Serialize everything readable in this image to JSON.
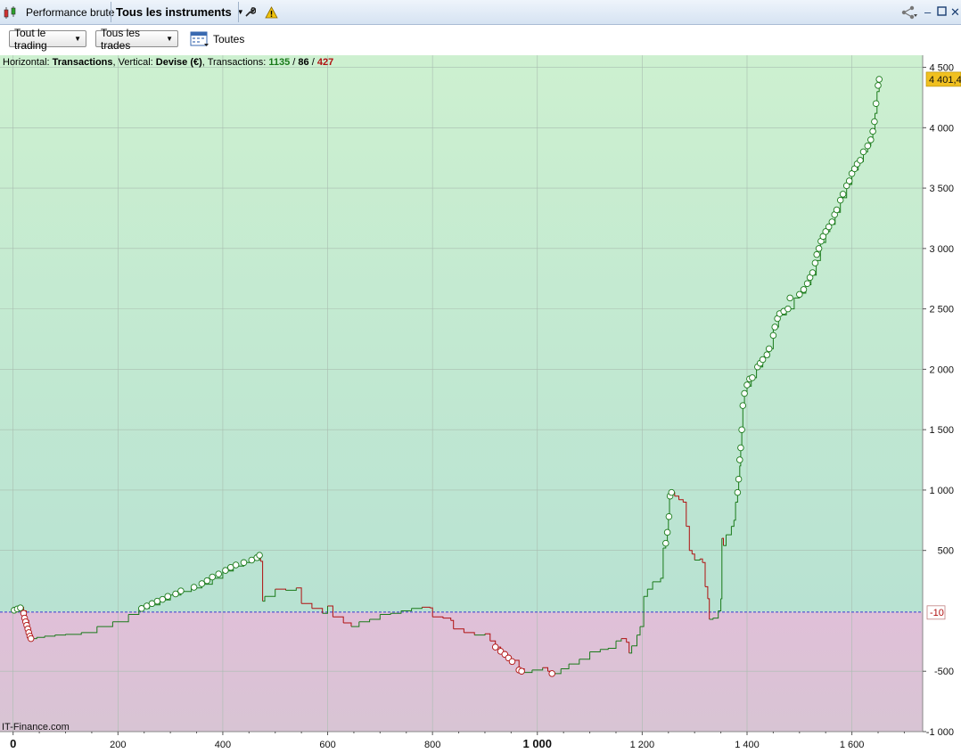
{
  "titlebar": {
    "tab_performance": "Performance brute",
    "tab_instruments": "Tous les instruments"
  },
  "toolbar": {
    "trading_filter": "Tout le trading",
    "trades_filter": "Tous les trades",
    "period_label": "Toutes"
  },
  "info": {
    "horizontal_prefix": "Horizontal: ",
    "horizontal_value": "Transactions",
    "vertical_prefix": ", Vertical: ",
    "vertical_value": "Devise (€)",
    "transactions_prefix": ", Transactions: ",
    "count_total": "1135",
    "sep1": " / ",
    "count_neutral": "86",
    "sep2": " / ",
    "count_losing": "427"
  },
  "watermark": "IT-Finance.com",
  "colors": {
    "profit_line": "#1a7a1a",
    "loss_line": "#b01010",
    "profit_zone": "#c8ecd0",
    "loss_zone": "#dcc2d4",
    "baseline": "#3a3ad0",
    "last_value_badge": "#f0c020"
  },
  "chart_data": {
    "type": "line",
    "xlabel": "Transactions",
    "ylabel": "Devise (€)",
    "xlim": [
      -25,
      1735
    ],
    "ylim": [
      -1000,
      4600
    ],
    "baseline_value": -10,
    "baseline_label": "-10",
    "last_value": 4401.4,
    "last_value_label": "4 401,4",
    "x_ticks": [
      {
        "v": 0,
        "label": "0",
        "bold": true
      },
      {
        "v": 200,
        "label": "200"
      },
      {
        "v": 400,
        "label": "400"
      },
      {
        "v": 600,
        "label": "600"
      },
      {
        "v": 800,
        "label": "800"
      },
      {
        "v": 1000,
        "label": "1 000",
        "bold": true
      },
      {
        "v": 1200,
        "label": "1 200"
      },
      {
        "v": 1400,
        "label": "1 400"
      },
      {
        "v": 1600,
        "label": "1 600"
      }
    ],
    "y_ticks": [
      {
        "v": 4500,
        "label": "4 500"
      },
      {
        "v": 4000,
        "label": "4 000"
      },
      {
        "v": 3500,
        "label": "3 500"
      },
      {
        "v": 3000,
        "label": "3 000"
      },
      {
        "v": 2500,
        "label": "2 500"
      },
      {
        "v": 2000,
        "label": "2 000"
      },
      {
        "v": 1500,
        "label": "1 500"
      },
      {
        "v": 1000,
        "label": "1 000"
      },
      {
        "v": 500,
        "label": "500"
      },
      {
        "v": -500,
        "label": "-500"
      },
      {
        "v": -1000,
        "label": "-1 000"
      }
    ],
    "series": [
      {
        "points": [
          [
            0,
            0
          ],
          [
            10,
            20
          ],
          [
            15,
            30
          ],
          [
            20,
            0
          ],
          [
            25,
            -80
          ],
          [
            30,
            -150
          ],
          [
            33,
            -200
          ],
          [
            36,
            -230
          ],
          [
            45,
            -220
          ],
          [
            60,
            -210
          ],
          [
            80,
            -200
          ],
          [
            100,
            -195
          ],
          [
            130,
            -180
          ],
          [
            160,
            -130
          ],
          [
            190,
            -90
          ],
          [
            220,
            -30
          ],
          [
            240,
            20
          ],
          [
            260,
            50
          ],
          [
            280,
            90
          ],
          [
            300,
            130
          ],
          [
            320,
            160
          ],
          [
            340,
            190
          ],
          [
            360,
            220
          ],
          [
            380,
            270
          ],
          [
            400,
            330
          ],
          [
            420,
            370
          ],
          [
            440,
            400
          ],
          [
            455,
            420
          ],
          [
            470,
            460
          ],
          [
            472,
            410
          ],
          [
            476,
            80
          ],
          [
            480,
            120
          ],
          [
            500,
            180
          ],
          [
            520,
            170
          ],
          [
            540,
            190
          ],
          [
            550,
            60
          ],
          [
            570,
            20
          ],
          [
            590,
            -20
          ],
          [
            600,
            40
          ],
          [
            610,
            -50
          ],
          [
            630,
            -100
          ],
          [
            645,
            -130
          ],
          [
            660,
            -90
          ],
          [
            680,
            -70
          ],
          [
            700,
            -30
          ],
          [
            720,
            -20
          ],
          [
            740,
            0
          ],
          [
            760,
            20
          ],
          [
            780,
            30
          ],
          [
            795,
            25
          ],
          [
            800,
            -50
          ],
          [
            820,
            -60
          ],
          [
            835,
            -80
          ],
          [
            840,
            -150
          ],
          [
            860,
            -180
          ],
          [
            880,
            -200
          ],
          [
            900,
            -190
          ],
          [
            910,
            -250
          ],
          [
            920,
            -300
          ],
          [
            930,
            -340
          ],
          [
            940,
            -380
          ],
          [
            950,
            -410
          ],
          [
            965,
            -480
          ],
          [
            975,
            -510
          ],
          [
            990,
            -490
          ],
          [
            1010,
            -470
          ],
          [
            1020,
            -500
          ],
          [
            1030,
            -520
          ],
          [
            1045,
            -480
          ],
          [
            1060,
            -440
          ],
          [
            1080,
            -400
          ],
          [
            1100,
            -340
          ],
          [
            1120,
            -320
          ],
          [
            1135,
            -310
          ],
          [
            1150,
            -250
          ],
          [
            1160,
            -230
          ],
          [
            1170,
            -260
          ],
          [
            1175,
            -350
          ],
          [
            1180,
            -290
          ],
          [
            1190,
            -200
          ],
          [
            1196,
            -130
          ],
          [
            1203,
            120
          ],
          [
            1210,
            180
          ],
          [
            1220,
            240
          ],
          [
            1235,
            270
          ],
          [
            1240,
            520
          ],
          [
            1245,
            560
          ],
          [
            1248,
            650
          ],
          [
            1250,
            780
          ],
          [
            1252,
            950
          ],
          [
            1256,
            980
          ],
          [
            1262,
            950
          ],
          [
            1270,
            920
          ],
          [
            1278,
            900
          ],
          [
            1284,
            700
          ],
          [
            1290,
            500
          ],
          [
            1295,
            470
          ],
          [
            1300,
            420
          ],
          [
            1310,
            430
          ],
          [
            1315,
            400
          ],
          [
            1320,
            200
          ],
          [
            1325,
            100
          ],
          [
            1328,
            -70
          ],
          [
            1335,
            -60
          ],
          [
            1345,
            0
          ],
          [
            1350,
            100
          ],
          [
            1352,
            600
          ],
          [
            1355,
            540
          ],
          [
            1360,
            630
          ],
          [
            1370,
            700
          ],
          [
            1375,
            750
          ],
          [
            1378,
            900
          ],
          [
            1382,
            980
          ],
          [
            1384,
            1070
          ],
          [
            1386,
            1200
          ],
          [
            1388,
            1350
          ],
          [
            1390,
            1500
          ],
          [
            1392,
            1700
          ],
          [
            1395,
            1800
          ],
          [
            1400,
            1860
          ],
          [
            1408,
            1930
          ],
          [
            1418,
            2020
          ],
          [
            1430,
            2100
          ],
          [
            1442,
            2170
          ],
          [
            1450,
            2350
          ],
          [
            1460,
            2450
          ],
          [
            1475,
            2500
          ],
          [
            1490,
            2590
          ],
          [
            1500,
            2630
          ],
          [
            1512,
            2700
          ],
          [
            1522,
            2780
          ],
          [
            1532,
            2900
          ],
          [
            1540,
            3050
          ],
          [
            1550,
            3140
          ],
          [
            1558,
            3200
          ],
          [
            1568,
            3300
          ],
          [
            1578,
            3420
          ],
          [
            1590,
            3530
          ],
          [
            1600,
            3650
          ],
          [
            1612,
            3720
          ],
          [
            1622,
            3800
          ],
          [
            1630,
            3850
          ],
          [
            1636,
            3900
          ],
          [
            1640,
            3980
          ],
          [
            1644,
            4120
          ],
          [
            1648,
            4300
          ],
          [
            1652,
            4401.4
          ]
        ],
        "markers": [
          [
            2,
            5
          ],
          [
            8,
            15
          ],
          [
            14,
            25
          ],
          [
            20,
            -20
          ],
          [
            22,
            -60
          ],
          [
            24,
            -90
          ],
          [
            26,
            -120
          ],
          [
            28,
            -150
          ],
          [
            30,
            -180
          ],
          [
            32,
            -210
          ],
          [
            34,
            -230
          ],
          [
            245,
            20
          ],
          [
            255,
            40
          ],
          [
            265,
            60
          ],
          [
            275,
            80
          ],
          [
            285,
            95
          ],
          [
            295,
            120
          ],
          [
            310,
            140
          ],
          [
            320,
            165
          ],
          [
            345,
            195
          ],
          [
            360,
            225
          ],
          [
            370,
            250
          ],
          [
            380,
            280
          ],
          [
            392,
            305
          ],
          [
            405,
            335
          ],
          [
            415,
            360
          ],
          [
            425,
            380
          ],
          [
            440,
            400
          ],
          [
            455,
            420
          ],
          [
            465,
            440
          ],
          [
            470,
            460
          ],
          [
            920,
            -300
          ],
          [
            930,
            -335
          ],
          [
            938,
            -360
          ],
          [
            945,
            -390
          ],
          [
            952,
            -420
          ],
          [
            965,
            -490
          ],
          [
            970,
            -500
          ],
          [
            1028,
            -520
          ],
          [
            1245,
            560
          ],
          [
            1248,
            650
          ],
          [
            1251,
            780
          ],
          [
            1253,
            950
          ],
          [
            1256,
            980
          ],
          [
            1382,
            980
          ],
          [
            1384,
            1090
          ],
          [
            1386,
            1250
          ],
          [
            1388,
            1350
          ],
          [
            1390,
            1500
          ],
          [
            1392,
            1700
          ],
          [
            1395,
            1800
          ],
          [
            1400,
            1870
          ],
          [
            1405,
            1920
          ],
          [
            1410,
            1930
          ],
          [
            1420,
            2020
          ],
          [
            1425,
            2050
          ],
          [
            1430,
            2080
          ],
          [
            1438,
            2120
          ],
          [
            1442,
            2170
          ],
          [
            1450,
            2280
          ],
          [
            1453,
            2350
          ],
          [
            1458,
            2420
          ],
          [
            1462,
            2460
          ],
          [
            1470,
            2480
          ],
          [
            1478,
            2500
          ],
          [
            1482,
            2590
          ],
          [
            1500,
            2620
          ],
          [
            1508,
            2660
          ],
          [
            1515,
            2710
          ],
          [
            1520,
            2760
          ],
          [
            1525,
            2800
          ],
          [
            1530,
            2880
          ],
          [
            1533,
            2950
          ],
          [
            1537,
            3000
          ],
          [
            1541,
            3060
          ],
          [
            1545,
            3100
          ],
          [
            1550,
            3140
          ],
          [
            1556,
            3180
          ],
          [
            1562,
            3220
          ],
          [
            1567,
            3280
          ],
          [
            1571,
            3320
          ],
          [
            1578,
            3400
          ],
          [
            1583,
            3450
          ],
          [
            1590,
            3520
          ],
          [
            1595,
            3560
          ],
          [
            1600,
            3620
          ],
          [
            1605,
            3660
          ],
          [
            1610,
            3700
          ],
          [
            1616,
            3730
          ],
          [
            1622,
            3800
          ],
          [
            1630,
            3850
          ],
          [
            1636,
            3900
          ],
          [
            1640,
            3970
          ],
          [
            1643,
            4050
          ],
          [
            1646,
            4200
          ],
          [
            1650,
            4350
          ],
          [
            1652,
            4401
          ]
        ]
      }
    ]
  }
}
